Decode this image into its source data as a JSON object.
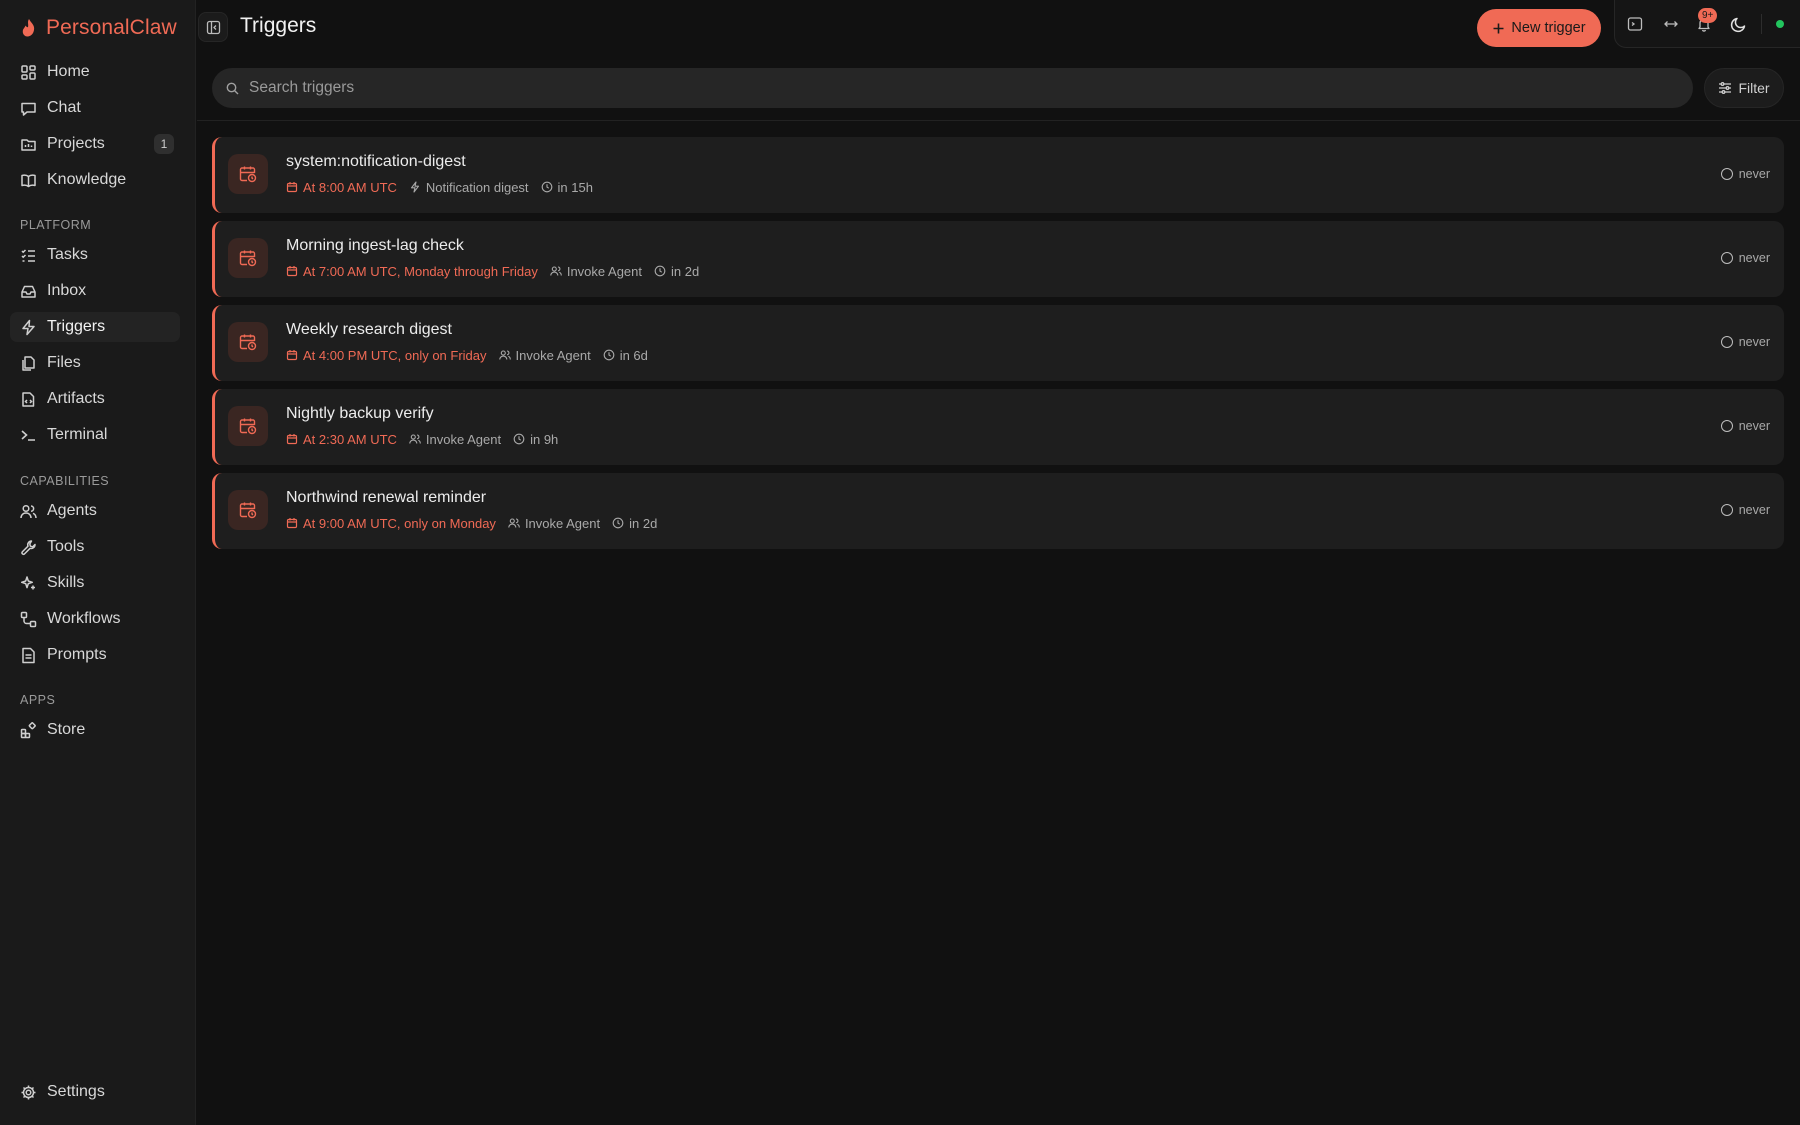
{
  "app": {
    "name": "PersonalClaw",
    "accent": "#f06a55"
  },
  "sidebar": {
    "main": [
      {
        "label": "Home",
        "icon": "home-grid-icon"
      },
      {
        "label": "Chat",
        "icon": "chat-bubble-icon"
      },
      {
        "label": "Projects",
        "icon": "projects-icon",
        "badge": "1"
      },
      {
        "label": "Knowledge",
        "icon": "book-icon"
      }
    ],
    "platform_label": "PLATFORM",
    "platform": [
      {
        "label": "Tasks",
        "icon": "task-list-icon"
      },
      {
        "label": "Inbox",
        "icon": "inbox-icon"
      },
      {
        "label": "Triggers",
        "icon": "lightning-icon",
        "active": true
      },
      {
        "label": "Files",
        "icon": "files-icon"
      },
      {
        "label": "Artifacts",
        "icon": "artifact-icon"
      },
      {
        "label": "Terminal",
        "icon": "terminal-icon"
      }
    ],
    "capabilities_label": "CAPABILITIES",
    "capabilities": [
      {
        "label": "Agents",
        "icon": "users-icon"
      },
      {
        "label": "Tools",
        "icon": "wrench-icon"
      },
      {
        "label": "Skills",
        "icon": "sparkle-icon"
      },
      {
        "label": "Workflows",
        "icon": "workflow-icon"
      },
      {
        "label": "Prompts",
        "icon": "document-icon"
      }
    ],
    "apps_label": "APPS",
    "apps": [
      {
        "label": "Store",
        "icon": "store-icon"
      }
    ],
    "settings_label": "Settings"
  },
  "header": {
    "title": "Triggers",
    "new_button_label": "New trigger",
    "notification_count": "9+"
  },
  "search": {
    "placeholder": "Search triggers",
    "value": ""
  },
  "filter_label": "Filter",
  "triggers": [
    {
      "name": "system:notification-digest",
      "schedule": "At 8:00 AM UTC",
      "action": "Notification digest",
      "action_icon": "lightning-icon",
      "next_run": "in 15h",
      "last_run": "never"
    },
    {
      "name": "Morning ingest-lag check",
      "schedule": "At 7:00 AM UTC, Monday through Friday",
      "action": "Invoke Agent",
      "action_icon": "users-icon",
      "next_run": "in 2d",
      "last_run": "never"
    },
    {
      "name": "Weekly research digest",
      "schedule": "At 4:00 PM UTC, only on Friday",
      "action": "Invoke Agent",
      "action_icon": "users-icon",
      "next_run": "in 6d",
      "last_run": "never"
    },
    {
      "name": "Nightly backup verify",
      "schedule": "At 2:30 AM UTC",
      "action": "Invoke Agent",
      "action_icon": "users-icon",
      "next_run": "in 9h",
      "last_run": "never"
    },
    {
      "name": "Northwind renewal reminder",
      "schedule": "At 9:00 AM UTC, only on Monday",
      "action": "Invoke Agent",
      "action_icon": "users-icon",
      "next_run": "in 2d",
      "last_run": "never"
    }
  ]
}
